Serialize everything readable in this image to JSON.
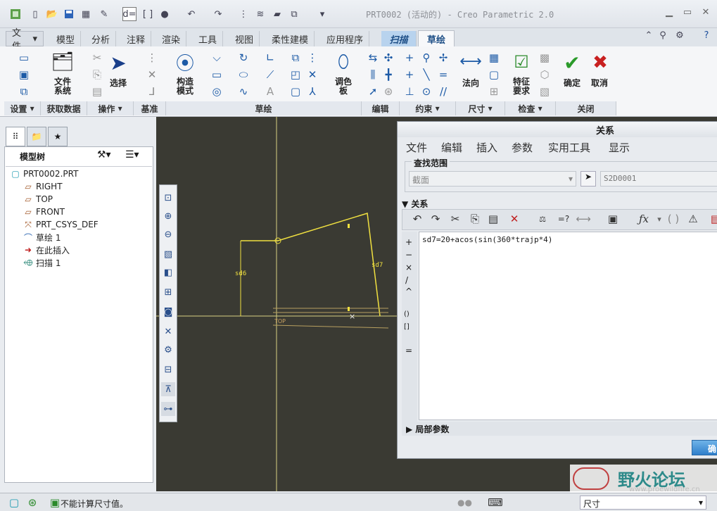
{
  "window": {
    "title": "PRT0002 (活动的) - Creo Parametric 2.0"
  },
  "tabs": [
    {
      "label": "文件",
      "type": "file"
    },
    {
      "label": "模型"
    },
    {
      "label": "分析"
    },
    {
      "label": "注释"
    },
    {
      "label": "渲染"
    },
    {
      "label": "工具"
    },
    {
      "label": "视图"
    },
    {
      "label": "柔性建模"
    },
    {
      "label": "应用程序"
    },
    {
      "label": "扫描",
      "type": "context"
    },
    {
      "label": "草绘",
      "type": "active"
    }
  ],
  "ribbon": {
    "groups": [
      "设置",
      "获取数据",
      "操作",
      "基准",
      "草绘",
      "编辑",
      "约束",
      "尺寸",
      "检查",
      "关闭"
    ],
    "buttons": {
      "file_system": "文件\n系统",
      "select": "选择",
      "construction": "构造\n模式",
      "palette": "调色\n板",
      "normal": "法向",
      "feature_req": "特征\n要求",
      "ok": "确定",
      "cancel": "取消"
    }
  },
  "model_tree": {
    "header": "模型树",
    "items": [
      {
        "label": "PRT0002.PRT",
        "icon": "part-icon",
        "level": 0
      },
      {
        "label": "RIGHT",
        "icon": "datum-plane-icon",
        "level": 1
      },
      {
        "label": "TOP",
        "icon": "datum-plane-icon",
        "level": 1
      },
      {
        "label": "FRONT",
        "icon": "datum-plane-icon",
        "level": 1
      },
      {
        "label": "PRT_CSYS_DEF",
        "icon": "csys-icon",
        "level": 1
      },
      {
        "label": "草绘 1",
        "icon": "sketch-icon",
        "level": 1
      },
      {
        "label": "在此插入",
        "icon": "insert-here-icon",
        "level": 1
      },
      {
        "label": "扫描 1",
        "icon": "sweep-icon",
        "level": 1
      }
    ]
  },
  "canvas": {
    "dim_sd6": "sd6",
    "dim_sd7": "sd7",
    "datum_label": "TOP"
  },
  "relations_dialog": {
    "title": "关系",
    "menu": [
      "文件",
      "编辑",
      "插入",
      "参数",
      "实用工具",
      "显示"
    ],
    "lookup_label": "查找范围",
    "lookup_type": "截面",
    "lookup_value": "S2D0001",
    "relations_section": "关系",
    "relation_text": "sd7=20+acos(sin(360*trajp*4)",
    "side_ops": [
      "+",
      "−",
      "×",
      "/",
      "^",
      "()",
      "[]",
      "="
    ],
    "local_params": "局部参数",
    "ok_button": "确"
  },
  "status": {
    "message": "不能计算尺寸值。",
    "filter": "尺寸"
  },
  "watermark": {
    "text": "野火论坛",
    "url": "www.proewildfire.cn"
  }
}
